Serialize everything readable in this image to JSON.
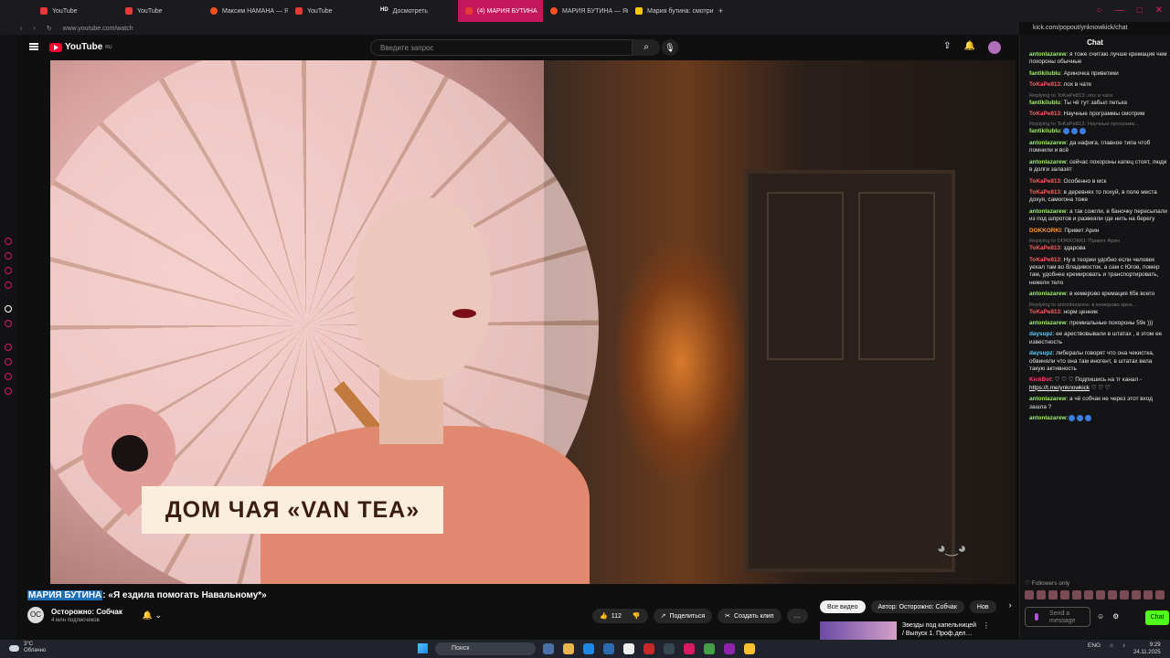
{
  "browser": {
    "tabs": [
      {
        "label": "YouTube",
        "favicon": "youtube-icon"
      },
      {
        "label": "YouTube",
        "favicon": "youtube-icon"
      },
      {
        "label": "Максим НАМАНА — Янд…",
        "favicon": "opera-icon"
      },
      {
        "label": "YouTube",
        "favicon": "youtube-icon"
      },
      {
        "label": "Досмотреть",
        "favicon": "HD"
      },
      {
        "label": "(4) МАРИЯ БУТИНА",
        "favicon": "audio-icon",
        "active": true
      },
      {
        "label": "МАРИЯ БУТИНА — Янд…",
        "favicon": "opera-icon"
      },
      {
        "label": "Мария бутина: смотрит…",
        "favicon": "yandex-icon"
      }
    ],
    "new_tab": "+",
    "url": "www.youtube.com/watch",
    "chat_url": "kick.com/popout/ynknowkick/chat"
  },
  "youtube": {
    "logo_text": "YouTube",
    "logo_region": "RU",
    "search_placeholder": "Введите запрос",
    "notification_count": "9+"
  },
  "video": {
    "overlay_caption": "ДОМ ЧАЯ «VAN TEA»",
    "title_highlight": "МАРИЯ БУТИНА",
    "title_rest": ": «Я ездила помогать Навальному*»",
    "channel_name": "Осторожно: Собчак",
    "channel_initials": "ОС",
    "subscribers": "4 млн подписчиков",
    "likes": "112",
    "share_label": "Поделиться",
    "clip_label": "Создать клип"
  },
  "recommendations": {
    "chips": [
      "Все видео",
      "Автор: Осторожно: Собчак",
      "Нов"
    ],
    "first_title": "Звезды под капельницей / Выпуск 1. Проф.дел…"
  },
  "chat": {
    "title": "Chat",
    "messages": [
      {
        "user": "antonlazarew",
        "ucls": "u1",
        "text": ": я тоже считаю лучше кремация чем похороны обычные"
      },
      {
        "user": "fantikilublu",
        "ucls": "u1",
        "text": ": Ариночка приветики"
      },
      {
        "user": "ToKaPe813",
        "ucls": "u2",
        "text": ": лох в чате"
      },
      {
        "reply": "Replying to ToKaPe813: лох в чате",
        "user": "fantikilublu",
        "ucls": "u1",
        "text": ": Ты чё тут забыл петька"
      },
      {
        "user": "ToKaPe813",
        "ucls": "u2",
        "text": ": Научные программы смотрим"
      },
      {
        "reply": "Replying to ToKaPe813: Научные программ…",
        "user": "fantikilublu",
        "ucls": "u1",
        "text": ":"
      },
      {
        "user": "antonlazarew",
        "ucls": "u1",
        "text": ": да нафига, главное типа чтоб помнили и всё"
      },
      {
        "user": "antonlazarew",
        "ucls": "u1",
        "text": ": сейчас похороны капец стоят, люди в долги залазят"
      },
      {
        "user": "ToKaPe813",
        "ucls": "u2",
        "text": ": Особенно в мск"
      },
      {
        "user": "ToKaPe813",
        "ucls": "u2",
        "text": ": в деревнях то похуй, в поле места дохуя, самогона тоже"
      },
      {
        "user": "antonlazarew",
        "ucls": "u1",
        "text": ": а так сожгли, в баночку пересыпали из под шпротов и развеяли где нить на берегу"
      },
      {
        "user": "DOKKORKI",
        "ucls": "u3",
        "text": ": Привет Арин"
      },
      {
        "reply": "Replying to DOKKORKI: Привет Арин",
        "user": "ToKaPe813",
        "ucls": "u2",
        "text": ": здарова"
      },
      {
        "user": "ToKaPe813",
        "ucls": "u2",
        "text": ": Ну в теории удобно если человек уехал там во Владивосток, а сам с Югов, помер там, удобнее кремировать и транспортировать, нежели тело"
      },
      {
        "user": "antonlazarew",
        "ucls": "u1",
        "text": ": в кемерово кремация 65к всего"
      },
      {
        "reply": "Replying to antonlazarew: в кемерово креа…",
        "user": "ToKaPe813",
        "ucls": "u2",
        "text": ": норм ценник"
      },
      {
        "user": "antonlazarew",
        "ucls": "u1",
        "text": ": премиальные похороны 59к )))"
      },
      {
        "user": "daysupz",
        "ucls": "u4",
        "text": ": ее арествовывали в штатах , в этом ее известность"
      },
      {
        "user": "daysupz",
        "ucls": "u4",
        "text": ": либералы говорят что она чекистка, обвиняли что она там иногент, в штатах вела такую активность"
      },
      {
        "user": "KickBot",
        "ucls": "u5",
        "text": ": ♡ ♡ ♡ Подпишись на тг канал - ",
        "link": "https://t.me/ynknowkick",
        "after": " ♡ ♡ ♡"
      },
      {
        "user": "antonlazarew",
        "ucls": "u1",
        "text": ": а чё собчак не через этот вход зашла ?"
      },
      {
        "user": "antonlazarew",
        "ucls": "u1",
        "text": ":"
      }
    ],
    "followers_only": "Followers only",
    "send_placeholder": "Send a message",
    "send_button": "Chat"
  },
  "taskbar": {
    "weather_temp": "3°C",
    "weather_desc": "Облачно",
    "search_label": "Поиск",
    "lang": "ENG",
    "time": "9:29",
    "date": "24.11.2025"
  }
}
